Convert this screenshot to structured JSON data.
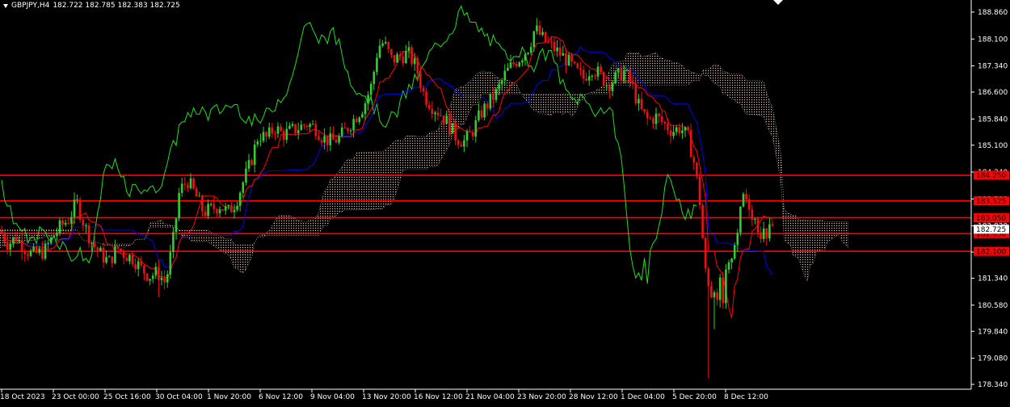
{
  "header": {
    "symbol": "GBPJPY,H4",
    "ohlc": "182.722 182.785 182.383 182.725"
  },
  "colors": {
    "background": "#000000",
    "axis": "#ffffff",
    "bull": "#33cc33",
    "bear": "#ee1111",
    "tenkan": "#ff0000",
    "kijun": "#0000ee",
    "chikou": "#22dd22",
    "cloud": "#f5d5b8",
    "level": "#ff0000",
    "level_label_bg": "#ff0000",
    "price_label_bg": "#ffffff"
  },
  "chart_data": {
    "type": "candlestick",
    "symbol": "GBPJPY",
    "timeframe": "H4",
    "indicators": [
      "Ichimoku Kinko Hyo"
    ],
    "ylim": [
      178.2,
      188.9
    ],
    "y_ticks": [
      "188.860",
      "188.100",
      "187.340",
      "186.600",
      "185.840",
      "185.100",
      "184.340",
      "183.580",
      "182.820",
      "182.080",
      "181.340",
      "180.580",
      "179.840",
      "179.080",
      "178.340"
    ],
    "x_ticks": [
      "18 Oct 2023",
      "23 Oct 00:00",
      "25 Oct 16:00",
      "30 Oct 04:00",
      "1 Nov 20:00",
      "6 Nov 12:00",
      "9 Nov 04:00",
      "13 Nov 20:00",
      "16 Nov 12:00",
      "21 Nov 04:00",
      "23 Nov 20:00",
      "28 Nov 12:00",
      "1 Dec 04:00",
      "5 Dec 20:00",
      "8 Dec 12:00"
    ],
    "current_price": "182.725",
    "levels": [
      {
        "value": 184.25,
        "label": "184.250"
      },
      {
        "value": 183.525,
        "label": "183.525"
      },
      {
        "value": 183.05,
        "label": "183.050"
      },
      {
        "value": 182.6,
        "label": "182.650"
      },
      {
        "value": 182.1,
        "label": "182.100"
      }
    ],
    "price_path": [
      [
        0,
        182.7
      ],
      [
        10,
        182.3
      ],
      [
        20,
        182.5
      ],
      [
        30,
        182.2
      ],
      [
        40,
        182.0
      ],
      [
        55,
        182.1
      ],
      [
        65,
        182.5
      ],
      [
        75,
        182.8
      ],
      [
        85,
        183.0
      ],
      [
        95,
        183.5
      ],
      [
        105,
        182.8
      ],
      [
        115,
        182.3
      ],
      [
        125,
        182.0
      ],
      [
        135,
        181.8
      ],
      [
        145,
        182.2
      ],
      [
        155,
        182.0
      ],
      [
        165,
        181.9
      ],
      [
        175,
        181.6
      ],
      [
        185,
        181.4
      ],
      [
        195,
        181.5
      ],
      [
        205,
        181.2
      ],
      [
        215,
        182.5
      ],
      [
        222,
        183.8
      ],
      [
        232,
        184.1
      ],
      [
        242,
        183.7
      ],
      [
        252,
        183.2
      ],
      [
        262,
        183.3
      ],
      [
        272,
        183.4
      ],
      [
        282,
        183.2
      ],
      [
        292,
        183.5
      ],
      [
        300,
        184.0
      ],
      [
        310,
        184.6
      ],
      [
        320,
        185.4
      ],
      [
        330,
        185.3
      ],
      [
        340,
        185.6
      ],
      [
        350,
        185.4
      ],
      [
        360,
        185.5
      ],
      [
        370,
        185.6
      ],
      [
        380,
        185.7
      ],
      [
        390,
        185.6
      ],
      [
        400,
        185.3
      ],
      [
        410,
        185.2
      ],
      [
        420,
        185.3
      ],
      [
        430,
        185.6
      ],
      [
        440,
        185.9
      ],
      [
        450,
        186.2
      ],
      [
        460,
        186.8
      ],
      [
        468,
        187.9
      ],
      [
        475,
        188.0
      ],
      [
        485,
        187.5
      ],
      [
        495,
        187.6
      ],
      [
        505,
        187.7
      ],
      [
        515,
        187.3
      ],
      [
        525,
        186.5
      ],
      [
        535,
        186.2
      ],
      [
        545,
        186.0
      ],
      [
        555,
        185.7
      ],
      [
        565,
        185.3
      ],
      [
        575,
        185.2
      ],
      [
        585,
        185.5
      ],
      [
        595,
        186.0
      ],
      [
        605,
        186.3
      ],
      [
        615,
        186.6
      ],
      [
        625,
        187.1
      ],
      [
        635,
        187.4
      ],
      [
        645,
        187.6
      ],
      [
        655,
        187.9
      ],
      [
        662,
        188.4
      ],
      [
        672,
        188.1
      ],
      [
        682,
        187.9
      ],
      [
        692,
        187.7
      ],
      [
        702,
        187.5
      ],
      [
        712,
        187.2
      ],
      [
        722,
        187.0
      ],
      [
        732,
        187.3
      ],
      [
        742,
        187.1
      ],
      [
        752,
        186.8
      ],
      [
        762,
        187.0
      ],
      [
        772,
        187.2
      ],
      [
        782,
        186.8
      ],
      [
        792,
        186.1
      ],
      [
        802,
        185.8
      ],
      [
        812,
        185.9
      ],
      [
        822,
        185.7
      ],
      [
        832,
        185.5
      ],
      [
        842,
        185.6
      ],
      [
        852,
        185.3
      ],
      [
        860,
        184.5
      ],
      [
        866,
        183.5
      ],
      [
        872,
        181.8
      ],
      [
        878,
        180.9
      ],
      [
        884,
        181.2
      ],
      [
        890,
        180.9
      ],
      [
        896,
        181.0
      ],
      [
        902,
        181.6
      ],
      [
        908,
        182.3
      ],
      [
        914,
        182.8
      ],
      [
        920,
        183.7
      ],
      [
        926,
        183.5
      ],
      [
        932,
        183.1
      ],
      [
        938,
        182.8
      ],
      [
        944,
        182.5
      ],
      [
        950,
        182.7
      ],
      [
        956,
        182.7
      ]
    ]
  }
}
